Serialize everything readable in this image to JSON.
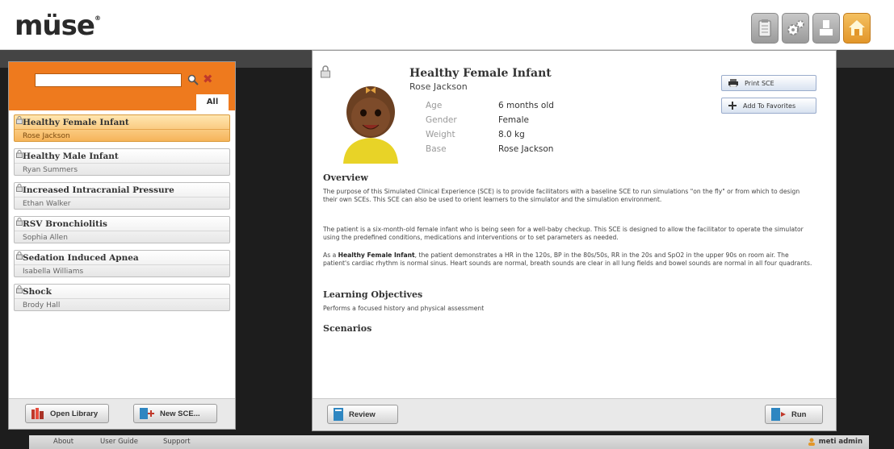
{
  "app": {
    "logo": "müse",
    "logo_mark": "®"
  },
  "header": {
    "buttons": [
      {
        "name": "clipboard-icon"
      },
      {
        "name": "gears-icon"
      },
      {
        "name": "user-icon"
      },
      {
        "name": "home-icon"
      }
    ]
  },
  "sidebar": {
    "search": {
      "value": "",
      "placeholder": ""
    },
    "tab_all": "All",
    "items": [
      {
        "title": "Healthy Female Infant",
        "patient": "Rose Jackson",
        "active": true
      },
      {
        "title": "Healthy Male Infant",
        "patient": "Ryan Summers",
        "active": false
      },
      {
        "title": "Increased Intracranial Pressure",
        "patient": "Ethan Walker",
        "active": false
      },
      {
        "title": "RSV Bronchiolitis",
        "patient": "Sophia Allen",
        "active": false
      },
      {
        "title": "Sedation Induced Apnea",
        "patient": "Isabella Williams",
        "active": false
      },
      {
        "title": "Shock",
        "patient": "Brody Hall",
        "active": false
      }
    ],
    "footer": {
      "open_library": "Open Library",
      "new_sce": "New SCE..."
    }
  },
  "main": {
    "title": "Healthy Female Infant",
    "patient": "Rose Jackson",
    "details": [
      {
        "label": "Age",
        "value": "6 months old"
      },
      {
        "label": "Gender",
        "value": "Female"
      },
      {
        "label": "Weight",
        "value": "8.0 kg"
      },
      {
        "label": "Base",
        "value": "Rose Jackson"
      }
    ],
    "print_label": "Print SCE",
    "favorites_label": "Add To Favorites",
    "overview": {
      "heading": "Overview",
      "p1": "The purpose of this Simulated Clinical Experience (SCE) is to provide facilitators with a baseline SCE to run simulations \"on the fly\" or from which to design their own SCEs. This SCE can also be used to orient learners to the simulator and the simulation environment.",
      "p2": "The patient is a six-month-old female infant who is being seen for a well-baby checkup.  This SCE is designed to allow the facilitator to operate the simulator using the predefined conditions, medications and interventions or to set parameters as needed.",
      "p3_pre": "As a ",
      "p3_bold": "Healthy Female Infant",
      "p3_post": ", the patient demonstrates a HR in the 120s, BP in the 80s/50s, RR in the 20s and SpO2 in the upper 90s on room air.  The patient's cardiac rhythm is normal sinus. Heart sounds are normal, breath sounds are clear in all lung fields and bowel sounds are normal in all four quadrants."
    },
    "objectives": {
      "heading": "Learning Objectives",
      "text": "Performs a focused history and physical assessment"
    },
    "scenarios": {
      "heading": "Scenarios"
    },
    "footer": {
      "review": "Review",
      "run": "Run"
    }
  },
  "bottombar": {
    "links": [
      "About",
      "User Guide",
      "Support"
    ],
    "user": "meti admin"
  }
}
